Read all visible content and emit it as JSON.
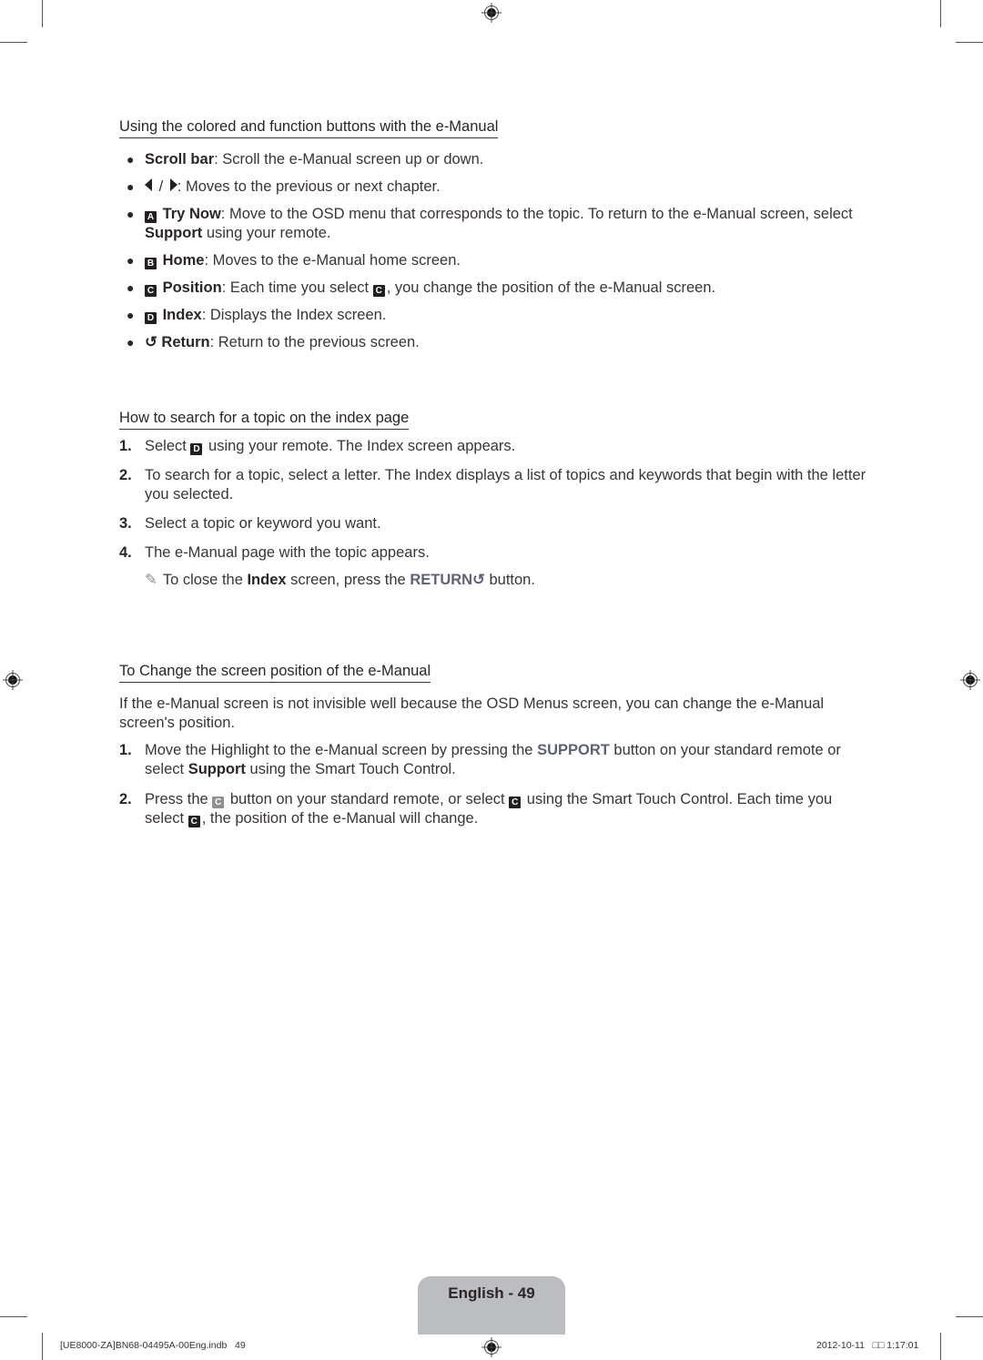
{
  "sections": {
    "buttons": {
      "title": "Using the colored and function buttons with the e-Manual",
      "items": [
        {
          "term": "Scroll bar",
          "text": ": Scroll the e-Manual screen up or down."
        },
        {
          "term_prefix": "",
          "text": ": Moves to the previous or next chapter.",
          "separator": "/"
        },
        {
          "key": "A",
          "term": "Try Now",
          "text": ": Move to the OSD menu that corresponds to the topic. To return to the e-Manual screen, select ",
          "bold2": "Support",
          "text2": " using your remote."
        },
        {
          "key": "B",
          "term": "Home",
          "text": ": Moves to the e-Manual home screen."
        },
        {
          "key": "C",
          "term": "Position",
          "text": ": Each time you select ",
          "key2": "C",
          "text2": ", you change the position of the e-Manual screen."
        },
        {
          "key": "D",
          "term": "Index",
          "text": ": Displays the Index screen."
        },
        {
          "glyph": "↺",
          "term": "Return",
          "text": ": Return to the previous screen."
        }
      ]
    },
    "index_search": {
      "title": "How to search for a topic on the index page",
      "steps": [
        {
          "num": "1.",
          "text_a": "Select ",
          "key": "D",
          "text_b": " using your remote. The Index screen appears."
        },
        {
          "num": "2.",
          "text": "To search for a topic, select a letter. The Index displays a list of topics and keywords that begin with the letter you selected."
        },
        {
          "num": "3.",
          "text": "Select a topic or keyword you want."
        },
        {
          "num": "4.",
          "text": "The e-Manual page with the topic appears."
        }
      ],
      "note": {
        "icon": "✎",
        "text_a": "To close the ",
        "bold": "Index",
        "text_b": " screen, press the ",
        "accent": "RETURN",
        "text_c": " button."
      }
    },
    "position": {
      "title": "To Change the screen position of the e-Manual",
      "intro": "If the e-Manual screen is not invisible well because the OSD Menus screen, you can change the e-Manual screen's position.",
      "steps": [
        {
          "num": "1.",
          "text_a": "Move the Highlight to the e-Manual screen by pressing the ",
          "accent": "SUPPORT",
          "text_b": " button on your standard remote or select ",
          "bold": "Support",
          "text_c": " using the Smart Touch Control."
        },
        {
          "num": "2.",
          "text_a": "Press the ",
          "key_gray": "C",
          "text_b": " button on your standard remote, or select ",
          "key": "C",
          "text_c": " using the Smart Touch Control. Each time you select ",
          "key3": "C",
          "text_d": ", the position of the e-Manual will change."
        }
      ]
    }
  },
  "page_tab": {
    "label": "English - 49"
  },
  "footer": {
    "file": "[UE8000-ZA]BN68-04495A-00Eng.indb   49",
    "timestamp": "2012-10-11   □□ 1:17:01"
  },
  "colors": {
    "accent": "#5d6178",
    "tab": "#bcbdc0",
    "text": "#3a3436"
  }
}
